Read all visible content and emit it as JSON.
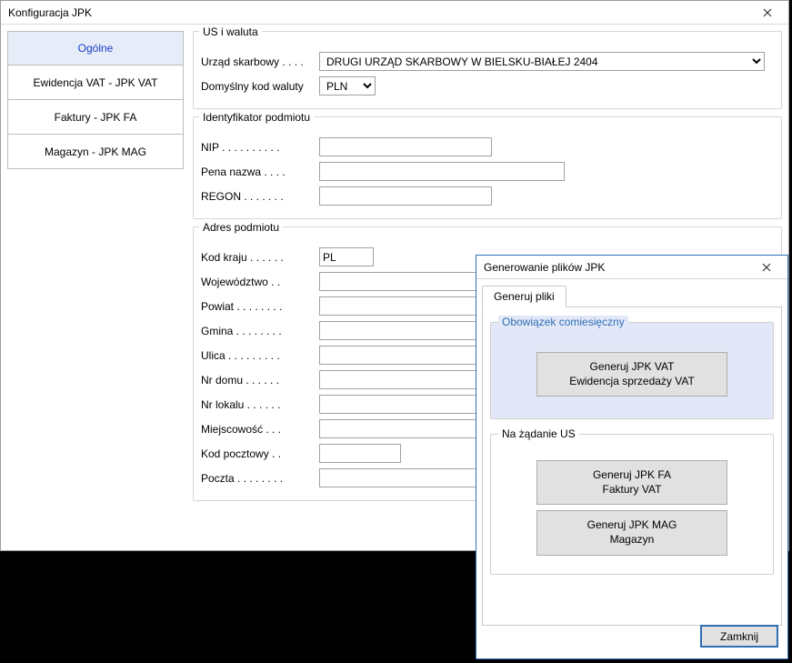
{
  "window": {
    "title": "Konfiguracja JPK"
  },
  "sidebar": {
    "items": [
      {
        "label": "Ogólne"
      },
      {
        "label": "Ewidencja VAT - JPK VAT"
      },
      {
        "label": "Faktury - JPK FA"
      },
      {
        "label": "Magazyn - JPK MAG"
      }
    ]
  },
  "groups": {
    "us_waluta": {
      "legend": "US i waluta",
      "urzad_label": "Urząd skarbowy . . . .",
      "urzad_value": "DRUGI URZĄD SKARBOWY W BIELSKU-BIAŁEJ  2404",
      "waluta_label": "Domyślny kod waluty",
      "waluta_value": "PLN"
    },
    "identyfikator": {
      "legend": "Identyfikator podmiotu",
      "nip_label": "NIP . . . . . . . . . .",
      "nip_value": "",
      "nazwa_label": "Pena nazwa . . . .",
      "nazwa_value": "",
      "regon_label": "REGON . . . . . . .",
      "regon_value": ""
    },
    "adres": {
      "legend": "Adres podmiotu",
      "kraj_label": "Kod kraju . . . . . .",
      "kraj_value": "PL",
      "woj_label": "Województwo . .",
      "woj_value": "",
      "powiat_label": "Powiat . . . . . . . .",
      "powiat_value": "",
      "gmina_label": "Gmina . . . . . . . .",
      "gmina_value": "",
      "ulica_label": "Ulica . . . . . . . . .",
      "ulica_value": "",
      "nrdomu_label": "Nr domu . . . . . .",
      "nrdomu_value": "",
      "nrlokalu_label": "Nr lokalu . . . . . .",
      "nrlokalu_value": "",
      "miejsc_label": "Miejscowość . . .",
      "miejsc_value": "",
      "kod_label": "Kod pocztowy . .",
      "kod_value": "",
      "poczta_label": "Poczta . . . . . . . .",
      "poczta_value": ""
    }
  },
  "modal": {
    "title": "Generowanie plików JPK",
    "tab_label": "Generuj pliki",
    "monthly": {
      "legend": "Obowiązek comiesięczny",
      "btn_vat": "Generuj JPK VAT\nEwidencja sprzedaży VAT"
    },
    "ondemand": {
      "legend": "Na żądanie US",
      "btn_fa": "Generuj JPK FA\nFaktury VAT",
      "btn_mag": "Generuj JPK MAG\nMagazyn"
    },
    "close_label": "Zamknij"
  }
}
